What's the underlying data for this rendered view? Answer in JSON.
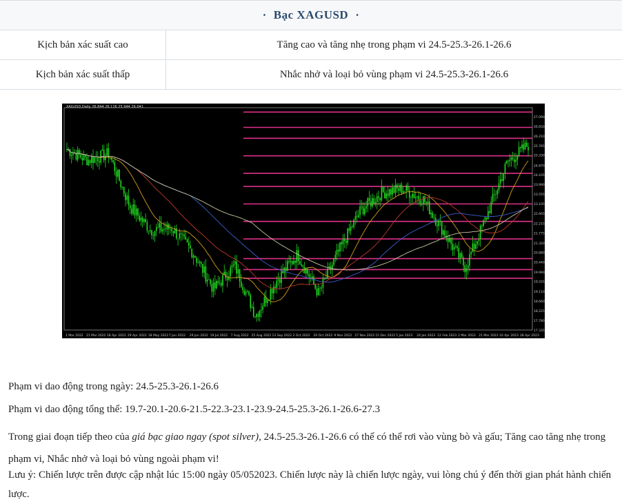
{
  "header": {
    "dot": "·",
    "title": "Bạc XAGUSD"
  },
  "scenarios": [
    {
      "label": "Kịch bản xác suất cao",
      "value": "Tăng cao và tăng nhẹ trong phạm vi 24.5-25.3-26.1-26.6"
    },
    {
      "label": "Kịch bản xác suất thấp",
      "value": "Nhắc nhở và loại bỏ vùng phạm vi 24.5-25.3-26.1-26.6"
    }
  ],
  "chart": {
    "caption": "XAGUSD,Daily  26.844 26.116 25.944 26.041",
    "x_labels": [
      "1 Mar 2022",
      "21 Mar 2022",
      "18 Apr 2022",
      "29 Apr 2022",
      "18 May 2022",
      "7 Jun 2022",
      "29 Jun 2022",
      "19 Jul 2022",
      "7 Aug 2022",
      "25 Aug 2022",
      "13 Sep 2022",
      "2 Oct 2022",
      "20 Oct 2022",
      "9 Nov 2022",
      "27 Nov 2022",
      "15 Dec 2022",
      "5 Jan 2023",
      "24 Jan 2023",
      "12 Feb 2023",
      "2 Mar 2023",
      "21 Mar 2023",
      "10 Apr 2023",
      "28 Apr 2023"
    ],
    "y_labels": [
      "27.090",
      "26.650",
      "26.210",
      "25.765",
      "25.330",
      "24.870",
      "24.435",
      "23.990",
      "23.555",
      "23.105",
      "22.665",
      "22.215",
      "21.775",
      "21.320",
      "20.880",
      "20.440",
      "19.990",
      "19.555",
      "19.110",
      "18.660",
      "18.225",
      "17.780",
      "17.335"
    ],
    "colors": {
      "bg": "#000000",
      "candle": "#22dd22",
      "level": "#e0308a",
      "grid": "#333333"
    }
  },
  "chart_data": {
    "type": "line",
    "title": "XAGUSD,Daily",
    "xlabel": "",
    "ylabel": "",
    "ylim": [
      17.335,
      27.5
    ],
    "x": [
      "1 Mar 2022",
      "21 Mar 2022",
      "18 Apr 2022",
      "29 Apr 2022",
      "18 May 2022",
      "7 Jun 2022",
      "29 Jun 2022",
      "19 Jul 2022",
      "7 Aug 2022",
      "25 Aug 2022",
      "13 Sep 2022",
      "2 Oct 2022",
      "20 Oct 2022",
      "9 Nov 2022",
      "27 Nov 2022",
      "15 Dec 2022",
      "5 Jan 2023",
      "24 Jan 2023",
      "12 Feb 2023",
      "2 Mar 2023",
      "21 Mar 2023",
      "10 Apr 2023",
      "28 Apr 2023"
    ],
    "series": [
      {
        "values": [
          25.6,
          25.1,
          25.4,
          23.0,
          21.9,
          22.0,
          20.9,
          19.2,
          20.3,
          18.0,
          19.6,
          20.8,
          19.0,
          21.0,
          22.8,
          23.6,
          23.8,
          23.3,
          21.8,
          20.2,
          22.5,
          25.0,
          25.8
        ]
      }
    ],
    "levels": [
      27.3,
      26.6,
      26.1,
      25.3,
      24.5,
      23.9,
      23.1,
      22.3,
      21.5,
      20.6,
      20.1,
      19.7
    ]
  },
  "body": {
    "intraday_label": "Phạm vi dao động trong ngày: ",
    "intraday_value": "24.5-25.3-26.1-26.6",
    "overall_label": "Phạm vi dao động tổng thể: ",
    "overall_value": "19.7-20.1-20.6-21.5-22.3-23.1-23.9-24.5-25.3-26.1-26.6-27.3",
    "para_a": "Trong giai đoạn tiếp theo của ",
    "para_italic": "giá bạc giao ngay (spot silver)",
    "para_b": ", 24.5-25.3-26.1-26.6 có thể có thể rơi vào vùng bò và gấu; Tăng cao tăng nhẹ trong phạm vi, Nhắc nhở và loại bỏ vùng ngoài phạm vi!",
    "note": "Lưu ý: Chiến lược trên được cập nhật lúc 15:00 ngày 05/052023. Chiến lược này là chiến lược ngày, vui lòng chú ý đến thời gian phát hành chiến lược."
  }
}
